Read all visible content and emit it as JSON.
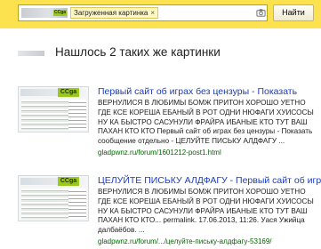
{
  "search": {
    "chip_label": "Загруженная картинка",
    "chip_close": "×",
    "logo_text": "ССga",
    "button_label": "Найти"
  },
  "colors": {
    "topbar": "#fde250",
    "link": "#1a3dc1",
    "url": "#006600"
  },
  "heading": {
    "text": "Нашлось 2 таких же картинки"
  },
  "results": [
    {
      "thumb_logo": "ССga",
      "title": "Первый сайт об играх без цензуры - Показать",
      "snippet": "ВЕРНУЛИСЯ В ЛЮБИМЫ БОМЖ ПРИТОН ХОРОШО УЕТНО ГДЕ КСЕ КОРЕША ЕБАНЫЙ В РОТ ОДНИ НЮФАГИ ХУИСОСЫ НУ КА БЫСТРО САСУНУЛИ ФРАЙРА ИБАНЫЕ КТО ТУТ ВАШ ПАХАН КТО КТО Первый сайт об играх без цензуры - Показать сообщение отдельно - ЦЕЛУЙТЕ ПИСЬКУ АЛДФАГУ ...",
      "url": "gladpwnz.ru/forum/1601212-post1.html"
    },
    {
      "thumb_logo": "ССga",
      "title": "ЦЕЛУЙТЕ ПИСЬКУ АЛДФАГУ - Первый сайт об играх",
      "snippet": "ВЕРНУЛИСЯ В ЛЮБИМЫ БОМЖ ПРИТОН ХОРОШО УЕТНО ГДЕ КСЕ КОРЕША ЕБАНЫЙ В РОТ ОДНИ НЮФАГИ ХУИСОСЫ НУ КА БЫСТРО САСУНУЛИ ФРАЙРА ИБАНЫЕ КТО ТУТ ВАШ ПАХАН КТО КТО... permalink. 17.06.2013, 11:26. Уася Ужийца далбаёбов. ...",
      "url": "gladpwnz.ru/forum/.../целуйте-письку-алдфагу-53169/"
    }
  ]
}
